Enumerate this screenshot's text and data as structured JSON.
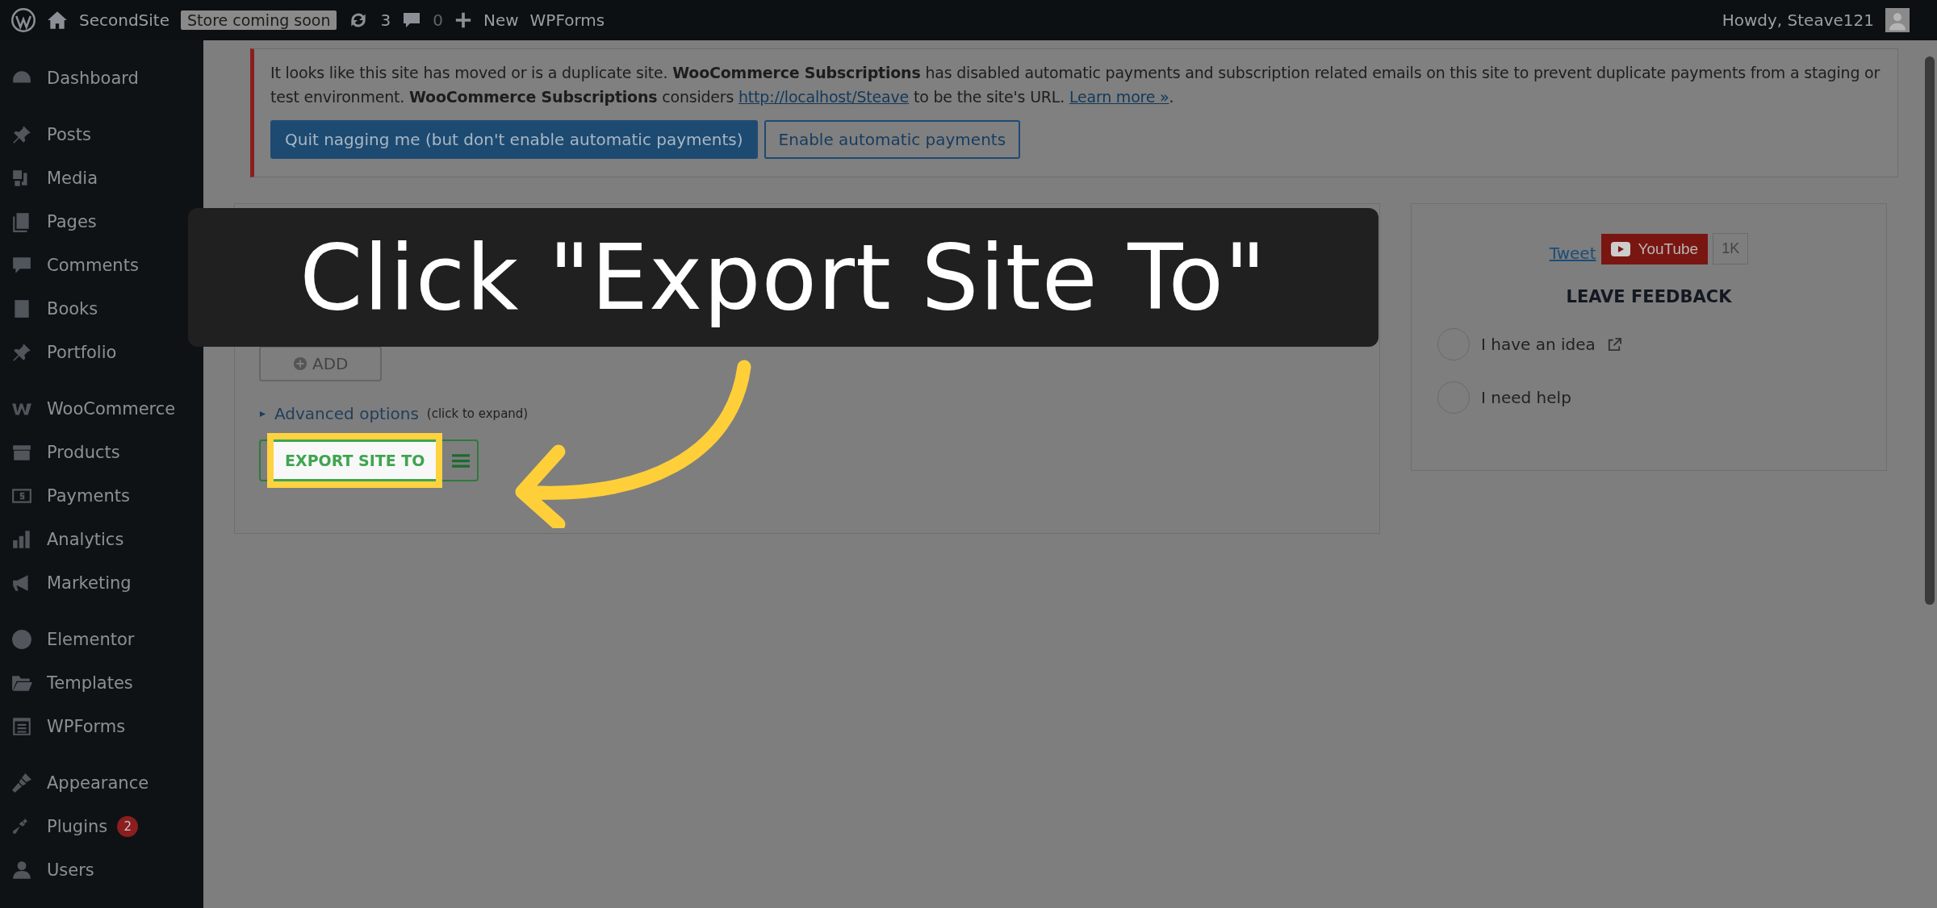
{
  "top_bar": {
    "site": "SecondSite",
    "store_badge": "Store coming soon",
    "updates": "3",
    "comments": "0",
    "new": "New",
    "plugin": "WPForms",
    "greeting": "Howdy, Steave121"
  },
  "sidebar": {
    "groups": [
      {
        "items": [
          {
            "label": "Dashboard"
          }
        ]
      },
      {
        "items": [
          {
            "label": "Posts"
          },
          {
            "label": "Media"
          },
          {
            "label": "Pages"
          },
          {
            "label": "Comments"
          },
          {
            "label": "Books"
          },
          {
            "label": "Portfolio"
          }
        ]
      },
      {
        "items": [
          {
            "label": "WooCommerce"
          },
          {
            "label": "Products"
          },
          {
            "label": "Payments"
          },
          {
            "label": "Analytics"
          },
          {
            "label": "Marketing"
          }
        ]
      },
      {
        "items": [
          {
            "label": "Elementor"
          },
          {
            "label": "Templates"
          },
          {
            "label": "WPForms"
          }
        ]
      },
      {
        "items": [
          {
            "label": "Appearance"
          },
          {
            "label": "Plugins",
            "badge": "2"
          },
          {
            "label": "Users"
          }
        ]
      }
    ]
  },
  "notice": {
    "text": "It looks like this site has moved or is a duplicate site. **WooCommerce Subscriptions** has disabled automatic payments and subscription related emails on this site to prevent duplicate payments from a staging or test environment. **WooCommerce Subscriptions** considers",
    "link": "http://localhost/Steave",
    "text_after": "to be the site's URL.",
    "learn_more": "Learn more »",
    "text_end": ".",
    "buttons": [
      {
        "label": "Quit nagging me (but don't enable automatic payments)",
        "kind": "primary"
      },
      {
        "label": "Enable automatic payments",
        "kind": "secondary"
      }
    ]
  },
  "export_panel": {
    "add_button": "ADD",
    "advanced": "Advanced options",
    "advanced_hint": "(click to expand)",
    "export_button": "EXPORT SITE TO"
  },
  "side_card": {
    "tweet": "Tweet",
    "youtube": "YouTube",
    "youtube_count": "1K",
    "heading": "LEAVE FEEDBACK",
    "options": [
      {
        "label": "I have an idea",
        "external": true
      },
      {
        "label": "I need help",
        "external": false
      }
    ]
  },
  "callout": {
    "text": "Click \"Export Site To\""
  }
}
